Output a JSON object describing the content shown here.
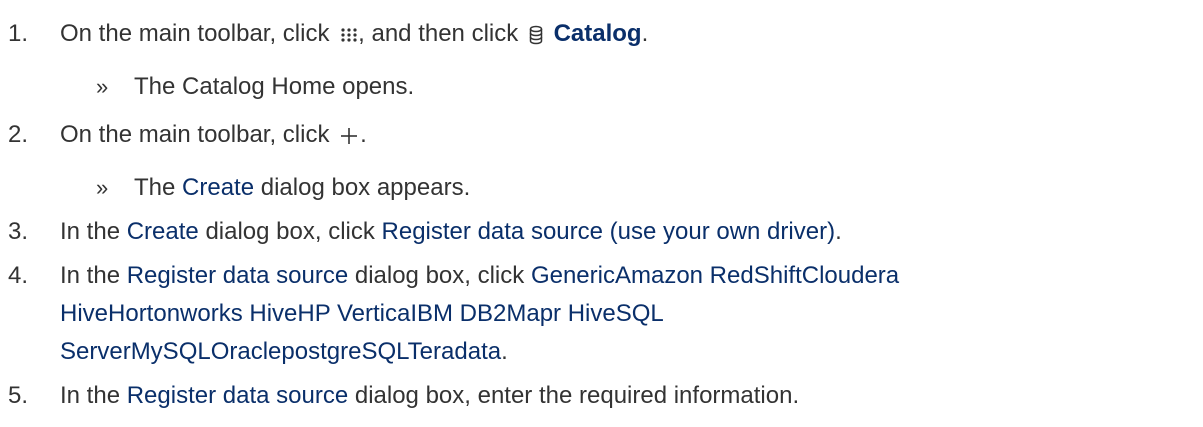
{
  "steps": [
    {
      "number": "1.",
      "parts": {
        "a": "On the main toolbar, click",
        "b": ", and then click",
        "c": "Catalog",
        "d": "."
      },
      "icons": [
        "apps-grid-icon",
        "database-icon"
      ],
      "result": "The Catalog Home opens."
    },
    {
      "number": "2.",
      "parts": {
        "a": "On the main toolbar, click",
        "b": "."
      },
      "icons": [
        "plus-icon"
      ],
      "result_prefix": "The",
      "result_ui": "Create",
      "result_suffix": "dialog box appears."
    },
    {
      "number": "3.",
      "parts": {
        "a": "In the",
        "b": "Create",
        "c": "dialog box, click",
        "d": "Register data source (use your own driver)",
        "e": "."
      }
    },
    {
      "number": "4.",
      "parts": {
        "a": "In the",
        "b": "Register data source",
        "c": "dialog box, click",
        "d1": "GenericAmazon RedShiftCloudera",
        "d2": "HiveHortonworks HiveHP VerticaIBM DB2Mapr HiveSQL",
        "d3": "ServerMySQLOraclepostgreSQLTeradata",
        "e": "."
      }
    },
    {
      "number": "5.",
      "parts": {
        "a": "In the",
        "b": "Register data source",
        "c": "dialog box, enter the required information."
      }
    }
  ],
  "result_marker": "»",
  "colors": {
    "body_text": "#333333",
    "ui_text": "#0a2f6a"
  }
}
